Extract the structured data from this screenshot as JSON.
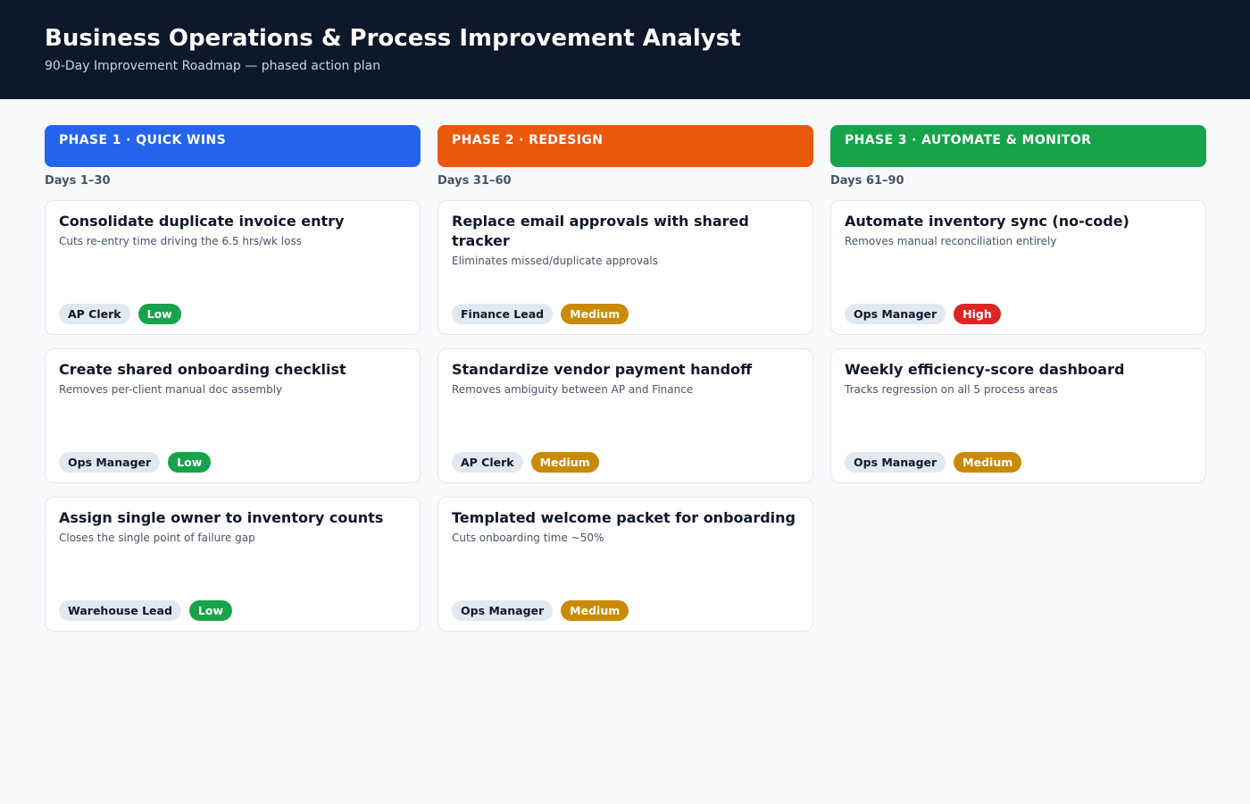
{
  "header": {
    "title": "Business Operations & Process Improvement Analyst",
    "subtitle": "90-Day Improvement Roadmap — phased action plan"
  },
  "colors": {
    "header_bg": "#0f172a",
    "phase_1": "#2563eb",
    "phase_2": "#ea580c",
    "phase_3": "#16a34a",
    "effort_low": "#16a34a",
    "effort_medium": "#ca8a04",
    "effort_high": "#dc2626"
  },
  "phases": [
    {
      "label": "PHASE 1 · QUICK WINS",
      "days": "Days 1–30",
      "tasks": [
        {
          "title": "Consolidate duplicate invoice entry",
          "description": "Cuts re-entry time driving the 6.5 hrs/wk loss",
          "owner": "AP Clerk",
          "effort": "Low"
        },
        {
          "title": "Create shared onboarding checklist",
          "description": "Removes per-client manual doc assembly",
          "owner": "Ops Manager",
          "effort": "Low"
        },
        {
          "title": "Assign single owner to inventory counts",
          "description": "Closes the single point of failure gap",
          "owner": "Warehouse Lead",
          "effort": "Low"
        }
      ]
    },
    {
      "label": "PHASE 2 · REDESIGN",
      "days": "Days 31–60",
      "tasks": [
        {
          "title": "Replace email approvals with shared tracker",
          "description": "Eliminates missed/duplicate approvals",
          "owner": "Finance Lead",
          "effort": "Medium"
        },
        {
          "title": "Standardize vendor payment handoff",
          "description": "Removes ambiguity between AP and Finance",
          "owner": "AP Clerk",
          "effort": "Medium"
        },
        {
          "title": "Templated welcome packet for onboarding",
          "description": "Cuts onboarding time ~50%",
          "owner": "Ops Manager",
          "effort": "Medium"
        }
      ]
    },
    {
      "label": "PHASE 3 · AUTOMATE & MONITOR",
      "days": "Days 61–90",
      "tasks": [
        {
          "title": "Automate inventory sync (no-code)",
          "description": "Removes manual reconciliation entirely",
          "owner": "Ops Manager",
          "effort": "High"
        },
        {
          "title": "Weekly efficiency-score dashboard",
          "description": "Tracks regression on all 5 process areas",
          "owner": "Ops Manager",
          "effort": "Medium"
        }
      ]
    }
  ]
}
